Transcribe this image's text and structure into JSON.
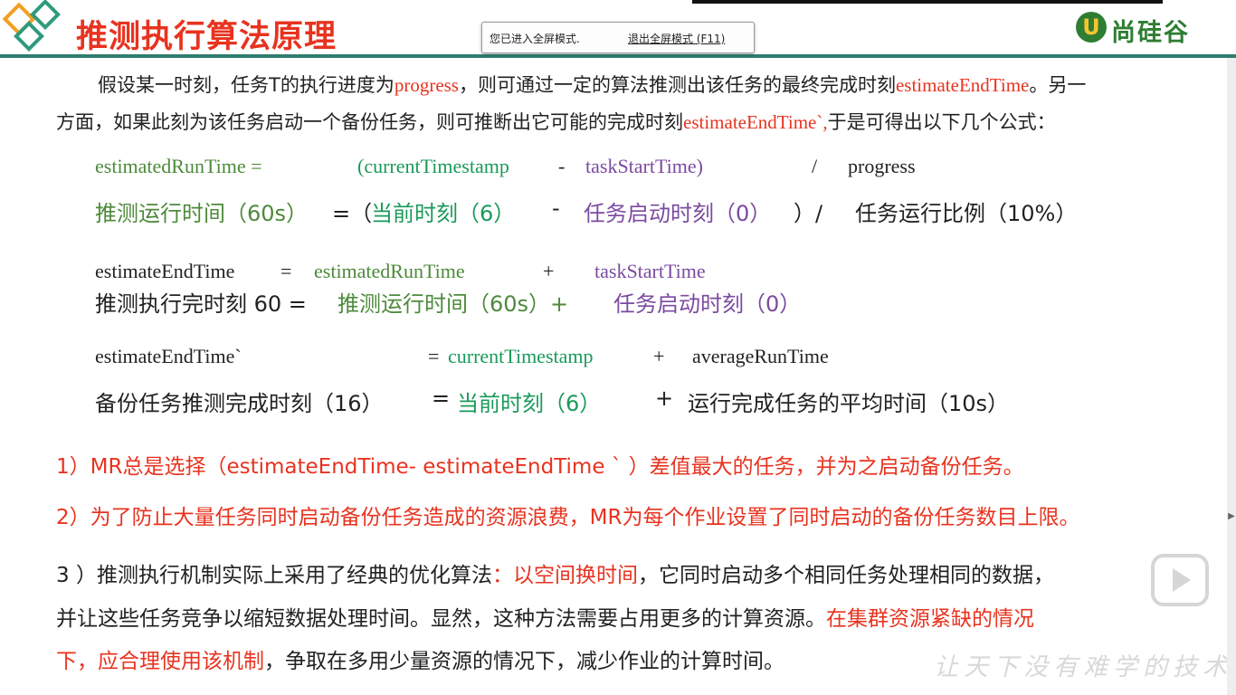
{
  "header": {
    "title": "推测执行算法原理",
    "logo_mark": "U",
    "logo_text": "尚硅谷"
  },
  "toast": {
    "message": "您已进入全屏模式.",
    "exit_link": "退出全屏模式 (F11)"
  },
  "intro": {
    "l1_a": "假设某一时刻，任务T的执行进度为",
    "l1_b": "progress",
    "l1_c": "，则可通过一定的算法推测出该任务的最终完成时刻",
    "l1_d": "estimateEndTime",
    "l1_e": "。另一",
    "l2_a": "方面，如果此刻为该任务启动一个备份任务，则可推断出它可能的完成时刻",
    "l2_b": "estimateEndTime`,",
    "l2_c": "于是可得出以下几个公式："
  },
  "formula1": {
    "a": "estimatedRunTime =",
    "b": "(currentTimestamp",
    "c": "-",
    "d": "taskStartTime)",
    "e": "/",
    "f": "progress",
    "cn_a": "推测运行时间（60s）",
    "cn_b": "=（",
    "cn_c": "当前时刻（6）",
    "cn_d": "-",
    "cn_e": "任务启动时刻（0）",
    "cn_f": "）/",
    "cn_g": "任务运行比例（10%）"
  },
  "formula2": {
    "a": "estimateEndTime",
    "b": "=",
    "c": "estimatedRunTime",
    "d": "+",
    "e": "taskStartTime",
    "cn_a": "推测执行完时刻 60 =",
    "cn_b": "推测运行时间（60s）+",
    "cn_c": "任务启动时刻（0）"
  },
  "formula3": {
    "a": "estimateEndTime`",
    "b": "=",
    "c": "currentTimestamp",
    "d": "+",
    "e": "averageRunTime",
    "cn_a": "备份任务推测完成时刻（16）",
    "cn_b": "=",
    "cn_c": "当前时刻（6）",
    "cn_d": "+",
    "cn_e": "运行完成任务的平均时间（10s）"
  },
  "points": {
    "p1": "1）MR总是选择（estimateEndTime- estimateEndTime ` ）差值最大的任务，并为之启动备份任务。",
    "p2": "2）为了防止大量任务同时启动备份任务造成的资源浪费，MR为每个作业设置了同时启动的备份任务数目上限。",
    "p3_a": "3 ）推测执行机制实际上采用了经典的优化算法",
    "p3_b": "：以空间换时间",
    "p3_c": "，它同时启动多个相同任务处理相同的数据，",
    "p3_l2_a": "并让这些任务竞争以缩短数据处理时间。显然，这种方法需要占用更多的计算资源。",
    "p3_l2_b": "在集群资源紧缺的情况",
    "p3_l3_a": "下，应合理使用该机制",
    "p3_l3_b": "，争取在多用少量资源的情况下，减少作业的计算时间。"
  },
  "watermark": "让天下没有难学的技术",
  "colors": {
    "title_red": "#e8331f",
    "header_line": "#2f7d6d",
    "green": "#4a8a3a",
    "teal": "#1a9a5a",
    "purple": "#7b4aa0"
  }
}
